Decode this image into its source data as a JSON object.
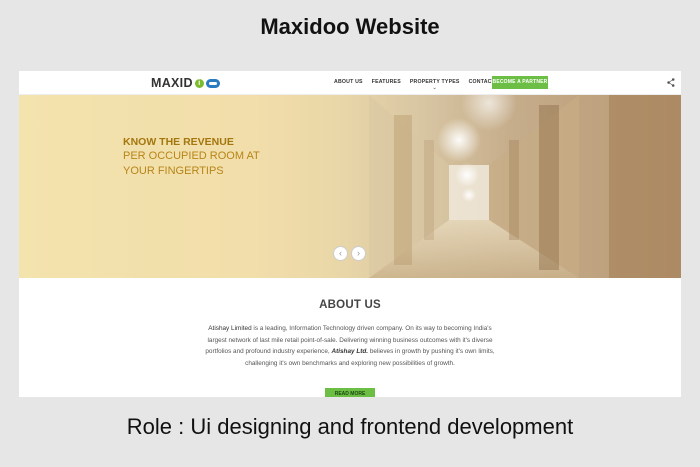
{
  "frame": {
    "title": "Maxidoo Website",
    "caption": "Role : Ui designing and frontend development"
  },
  "nav": {
    "logo_text": "MAXID",
    "logo_i": "i",
    "links": [
      "ABOUT US",
      "FEATURES",
      "PROPERTY TYPES",
      "CONTACT US"
    ],
    "cta": "BECOME A PARTNER",
    "share_icon": "share-icon"
  },
  "hero": {
    "line1": "KNOW THE REVENUE",
    "line2": "PER OCCUPIED ROOM AT",
    "line3": "YOUR FINGERTIPS",
    "prev_glyph": "‹",
    "next_glyph": "›"
  },
  "about": {
    "title": "ABOUT US",
    "brand": "Atishay Limited",
    "p1": " is a leading, Information Technology driven company. On its way to becoming India's largest network of last mile retail point-of-sale. Delivering winning business outcomes with it's diverse portfolios and profound industry experience, ",
    "brand_italic": "Atishay Ltd.",
    "p2": " believes in growth by pushing it's own limits, challenging it's own benchmarks and exploring new possibilities of growth.",
    "read_more": "READ MORE"
  },
  "colors": {
    "accent_green": "#6cbe45",
    "hero_gold": "#b78518",
    "logo_blue": "#2a7bc0"
  }
}
